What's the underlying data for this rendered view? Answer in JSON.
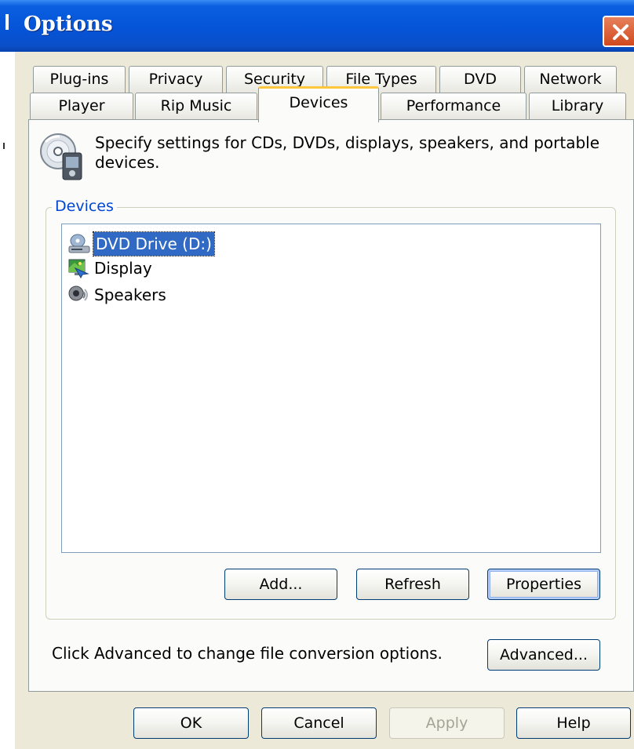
{
  "window": {
    "title": "Options"
  },
  "tabs": {
    "row1": [
      "Plug-ins",
      "Privacy",
      "Security",
      "File Types",
      "DVD",
      "Network"
    ],
    "row2": [
      "Player",
      "Rip Music",
      "Devices",
      "Performance",
      "Library"
    ],
    "active": "Devices"
  },
  "panel": {
    "description": "Specify settings for CDs, DVDs, displays, speakers, and portable devices.",
    "group_label": "Devices",
    "devices": [
      {
        "label": "DVD Drive (D:)",
        "icon": "dvd-drive-icon",
        "selected": true
      },
      {
        "label": "Display",
        "icon": "display-icon",
        "selected": false
      },
      {
        "label": "Speakers",
        "icon": "speakers-icon",
        "selected": false
      }
    ],
    "buttons": {
      "add": "Add...",
      "refresh": "Refresh",
      "properties": "Properties"
    },
    "advanced_text": "Click Advanced to change file conversion options.",
    "advanced_button": "Advanced..."
  },
  "dialog_buttons": {
    "ok": "OK",
    "cancel": "Cancel",
    "apply": "Apply",
    "help": "Help"
  },
  "colors": {
    "titlebar": "#0554d8",
    "selection": "#316ac5",
    "group_label": "#0046d5",
    "active_tab_accent": "#ffc83c"
  }
}
